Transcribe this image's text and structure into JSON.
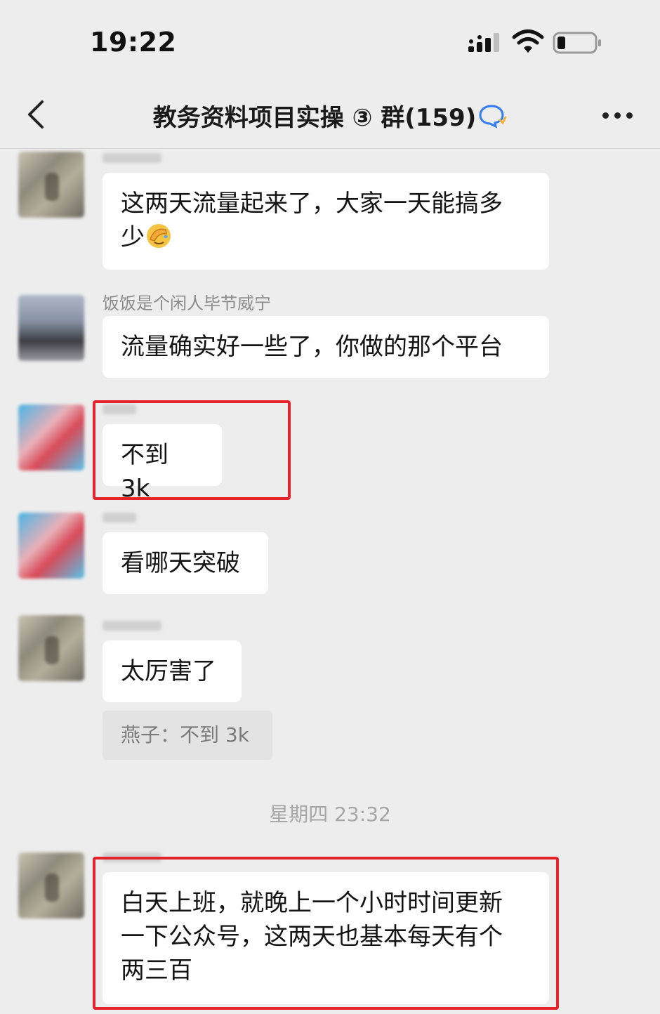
{
  "status_bar": {
    "time": "19:22",
    "icons": [
      "signal-icon",
      "wifi-icon",
      "battery-icon"
    ],
    "battery_level": 0.22
  },
  "nav": {
    "title": "教务资料项目实操 ③ 群",
    "member_count": "(159)",
    "icons": [
      "back-icon",
      "chat-bubble-icon",
      "more-icon"
    ]
  },
  "messages": [
    {
      "sender": "",
      "text_line1": "这两天流量起来了，大家一天能搞多",
      "text_line2": "少",
      "emoji": "facepalm-emoji"
    },
    {
      "sender": "饭饭是个闲人毕节威宁",
      "text": "流量确实好一些了，你做的那个平台"
    },
    {
      "sender": "",
      "text": "不到 3k"
    },
    {
      "sender": "",
      "text": "看哪天突破"
    },
    {
      "sender": "",
      "text": "太厉害了",
      "quote": "燕子：不到 3k"
    },
    {
      "sender": "",
      "text_line1": "白天上班，就晚上一个小时时间更新",
      "text_line2": "一下公众号，这两天也基本每天有个",
      "text_line3": "两三百"
    }
  ],
  "timestamp": "星期四 23:32",
  "colors": {
    "background": "#ededed",
    "bubble": "#ffffff",
    "highlight": "#e5232b",
    "name": "#8a8a8a"
  }
}
